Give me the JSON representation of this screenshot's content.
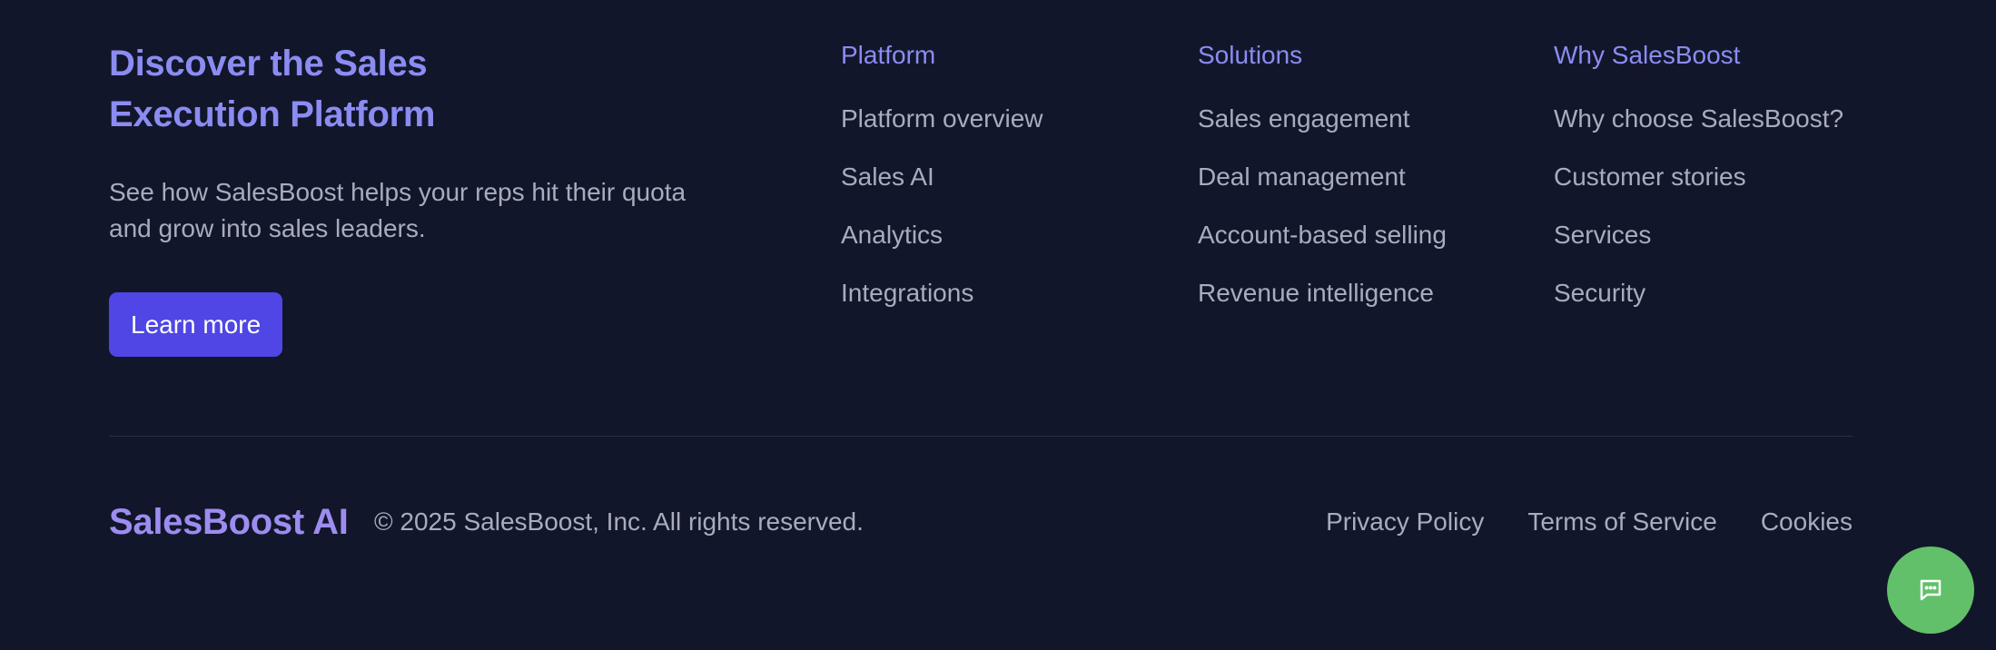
{
  "promo": {
    "title": "Discover the Sales\nExecution Platform",
    "text": "See how SalesBoost helps your reps hit their quota and grow into sales leaders.",
    "button_label": "Learn more"
  },
  "columns": [
    {
      "heading": "Platform",
      "items": [
        "Platform overview",
        "Sales AI",
        "Analytics",
        "Integrations"
      ]
    },
    {
      "heading": "Solutions",
      "items": [
        "Sales engagement",
        "Deal management",
        "Account-based selling",
        "Revenue intelligence"
      ]
    },
    {
      "heading": "Why SalesBoost",
      "items": [
        "Why choose SalesBoost?",
        "Customer stories",
        "Services",
        "Security"
      ]
    }
  ],
  "bottom": {
    "brand": "SalesBoost AI",
    "copyright": "© 2025 SalesBoost, Inc. All rights reserved.",
    "links": [
      "Privacy Policy",
      "Terms of Service",
      "Cookies"
    ]
  },
  "chat": {
    "icon": "chat-bubble-icon"
  },
  "colors": {
    "background": "#12162a",
    "accent": "#8b8cf2",
    "button": "#4f46e5",
    "chat": "#62c06a"
  }
}
